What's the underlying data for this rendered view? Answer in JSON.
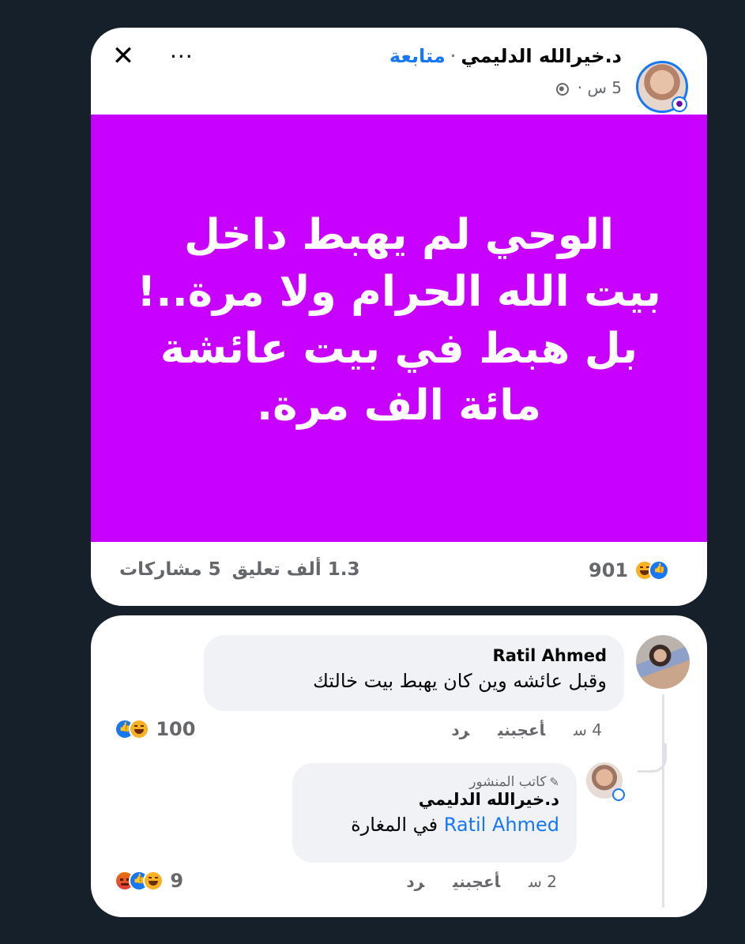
{
  "post": {
    "author": "د.خيرالله الدليمي",
    "separator": "·",
    "follow_label": "متابعة",
    "time": "5 س ·",
    "more_label": "···",
    "close_label": "✕",
    "image_text": [
      "الوحي لم يهبط داخل",
      "بيت الله الحرام ولا مرة..!",
      "بل هبط في بيت عائشة",
      "مائة الف مرة."
    ],
    "image_background": "#c800ff",
    "reactions_count": "901",
    "reaction_icons": [
      "like-icon",
      "haha-icon"
    ],
    "comments_count": "1.3 ألف تعليق",
    "shares_count": "5 مشاركات"
  },
  "comments": [
    {
      "name": "Ratil Ahmed",
      "text": "وقبل عائشه وين كان  يهبط  بيت خالتك",
      "time": "4 س",
      "like_label": "أعجبني",
      "reply_label": "رد",
      "reactions_count": "100",
      "reaction_icons": [
        "like-icon",
        "haha-icon"
      ]
    },
    {
      "badge": "كاتب المنشور",
      "badge_icon": "pencil-icon",
      "name": "د.خيرالله الدليمي",
      "mention": "Ratil Ahmed",
      "text": "في المغارة",
      "time": "2 س",
      "like_label": "أعجبني",
      "reply_label": "رد",
      "reactions_count": "9",
      "reaction_icons": [
        "angry-icon",
        "like-icon",
        "haha-icon"
      ]
    }
  ],
  "colors": {
    "background": "#15202b",
    "card": "#ffffff",
    "link": "#1877f2",
    "muted": "#65676b"
  }
}
